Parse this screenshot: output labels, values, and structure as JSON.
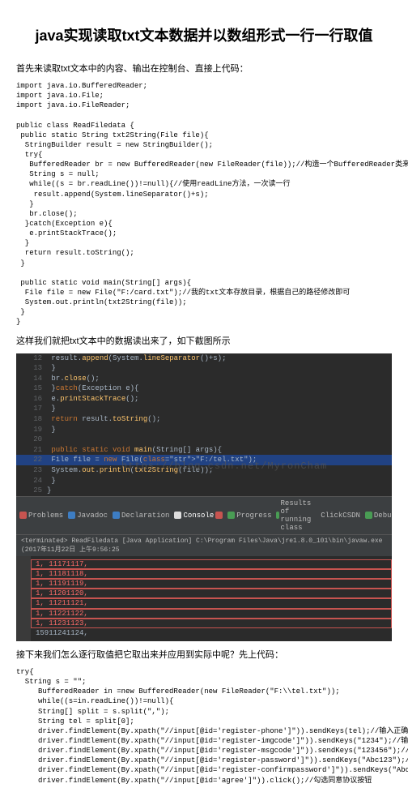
{
  "title": "java实现读取txt文本数据并以数组形式一行一行取值",
  "intro1": "首先来读取txt文本中的内容、输出在控制台、直接上代码：",
  "code1": "import java.io.BufferedReader;\nimport java.io.File;\nimport java.io.FileReader;\n\npublic class ReadFiledata {\n public static String txt2String(File file){\n  StringBuilder result = new StringBuilder();\n  try{\n   BufferedReader br = new BufferedReader(new FileReader(file));//构造一个BufferedReader类来读取文件\n   String s = null;\n   while((s = br.readLine())!=null){//使用readLine方法，一次读一行\n    result.append(System.lineSeparator()+s);\n   }\n   br.close();\n  }catch(Exception e){\n   e.printStackTrace();\n  }\n  return result.toString();\n }\n\n public static void main(String[] args){\n  File file = new File(\"F:/card.txt\");//我的txt文本存放目录，根据自己的路径修改即可\n  System.out.println(txt2String(file));\n }\n}",
  "intro2": "这样我们就把txt文本中的数据读出来了，如下截图所示",
  "editor_lines": [
    {
      "n": "12",
      "t": "                result.append(System.lineSeparator()+s);"
    },
    {
      "n": "13",
      "t": "            }"
    },
    {
      "n": "14",
      "t": "            br.close();"
    },
    {
      "n": "15",
      "t": "        }catch(Exception e){"
    },
    {
      "n": "16",
      "t": "            e.printStackTrace();"
    },
    {
      "n": "17",
      "t": "        }"
    },
    {
      "n": "18",
      "t": "        return result.toString();"
    },
    {
      "n": "19",
      "t": "    }"
    },
    {
      "n": "20",
      "t": ""
    },
    {
      "n": "21",
      "t": "    public static void main(String[] args){"
    },
    {
      "n": "22",
      "t": "        File file = new File(\"F:/tel.txt\");",
      "hl": true
    },
    {
      "n": "23",
      "t": "        System.out.println(txt2String(file));"
    },
    {
      "n": "24",
      "t": "    }"
    },
    {
      "n": "25",
      "t": "}"
    }
  ],
  "watermark": "https://blog.csdn.net/MyronCham",
  "toolbar": {
    "problems": "Problems",
    "javadoc": "Javadoc",
    "declaration": "Declaration",
    "console": "Console",
    "progress": "Progress",
    "results": "Results of running class",
    "clickcsdn": "ClickCSDN",
    "debug": "Debu"
  },
  "termline": "<terminated> ReadFiledata [Java Application] C:\\Program Files\\Java\\jre1.8.0_101\\bin\\javaw.exe  (2017年11月22日  上午9:56:25",
  "output": [
    "1, 11171117,",
    "1, 11181118,",
    "1, 11191119,",
    "1, 11201120,",
    "1, 11211121,",
    "1, 11221122,",
    "1, 11231123,",
    "15911241124,"
  ],
  "intro3": "接下来我们怎么逐行取值把它取出来并应用到实际中呢？先上代码：",
  "code2": "try{\n  String s = \"\";\n     BufferedReader in =new BufferedReader(new FileReader(\"F:\\\\tel.txt\"));\n     while((s=in.readLine())!=null){\n     String[] split = s.split(\",\");\n     String tel = split[0];\n     driver.findElement(By.xpath(\"//input[@id='register-phone']\")).sendKeys(tel);//输入正确手机号\n     driver.findElement(By.xpath(\"//input[@id='register-imgcode']\")).sendKeys(\"1234\");//输入图片验证码\n     driver.findElement(By.xpath(\"//input[@id='register-msgcode']\")).sendKeys(\"123456\");//输入短信验证码\n     driver.findElement(By.xpath(\"//input[@id='register-password']\")).sendKeys(\"Abc123\");//输入正确密码\n     driver.findElement(By.xpath(\"//input[@id='register-confirmpassword']\")).sendKeys(\"Abc123\");//再次输入确认密码\n     driver.findElement(By.xpath(\"//input[@id='agree']\")).click();//勾选同意协议按钮"
}
